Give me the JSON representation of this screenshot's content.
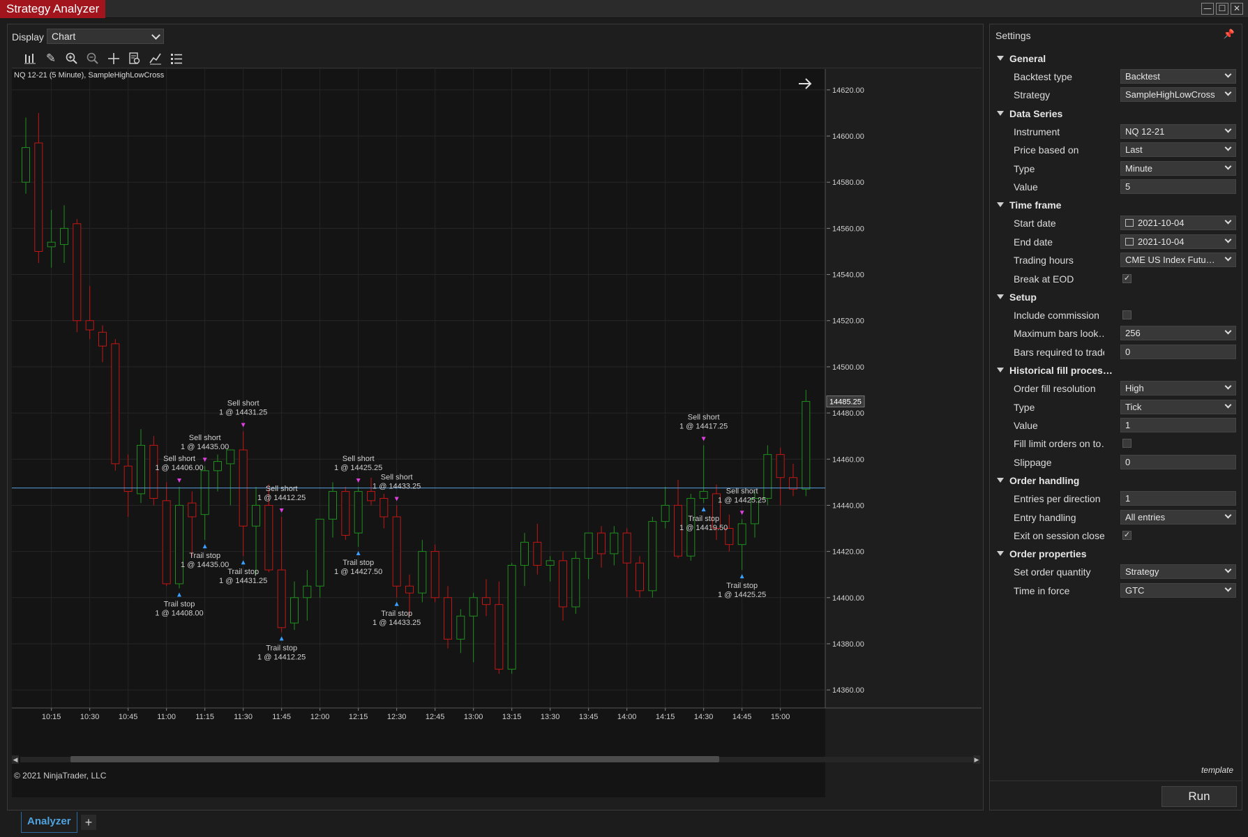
{
  "app_title": "Strategy Analyzer",
  "window_controls": [
    "minimize-icon",
    "maximize-icon",
    "close-icon"
  ],
  "display": {
    "label": "Display",
    "value": "Chart"
  },
  "toolbar_icons": [
    "bar-type-icon",
    "drawing-tool-icon",
    "zoom-in-icon",
    "zoom-out-icon",
    "crosshair-icon",
    "data-box-icon",
    "indicator-icon",
    "properties-list-icon"
  ],
  "chart": {
    "title": "NQ 12-21 (5 Minute), SampleHighLowCross",
    "copyright": "© 2021 NinjaTrader, LLC",
    "last_price_label": "14485.25",
    "horizontal_line_price": 14447.5
  },
  "chart_data": {
    "type": "candlestick",
    "instrument": "NQ 12-21",
    "interval": "5 Minute",
    "x_tick_labels": [
      "10:15",
      "10:30",
      "10:45",
      "11:00",
      "11:15",
      "11:30",
      "11:45",
      "12:00",
      "12:15",
      "12:30",
      "12:45",
      "13:00",
      "13:15",
      "13:30",
      "13:45",
      "14:00",
      "14:15",
      "14:30",
      "14:45",
      "15:00"
    ],
    "y_tick_labels": [
      "14620.00",
      "14600.00",
      "14580.00",
      "14560.00",
      "14540.00",
      "14520.00",
      "14500.00",
      "14480.00",
      "14460.00",
      "14440.00",
      "14420.00",
      "14400.00",
      "14380.00",
      "14360.00"
    ],
    "ylim": [
      14354,
      14626
    ],
    "first_bar_time": "10:05",
    "bar_minutes": 5,
    "colors": {
      "up": "#1f8f1f",
      "down": "#c41616",
      "up_fill": "#141414",
      "down_fill": "#141414",
      "grid": "#262626",
      "hline": "#5aa0e0"
    },
    "candles": [
      [
        14580,
        14608,
        14575,
        14595
      ],
      [
        14597,
        14610,
        14545,
        14550
      ],
      [
        14552,
        14568,
        14543,
        14554
      ],
      [
        14553,
        14570,
        14545,
        14560
      ],
      [
        14562,
        14564,
        14515,
        14520
      ],
      [
        14520,
        14535,
        14512,
        14516
      ],
      [
        14515,
        14518,
        14502,
        14509
      ],
      [
        14510,
        14512,
        14455,
        14458
      ],
      [
        14457,
        14462,
        14435,
        14446
      ],
      [
        14445,
        14473,
        14441,
        14466
      ],
      [
        14466,
        14470,
        14440,
        14443
      ],
      [
        14442,
        14450,
        14405,
        14406
      ],
      [
        14406,
        14448,
        14404,
        14440
      ],
      [
        14441,
        14446,
        14418,
        14435
      ],
      [
        14436,
        14457,
        14425,
        14455
      ],
      [
        14455,
        14462,
        14446,
        14459
      ],
      [
        14458,
        14463,
        14440,
        14464
      ],
      [
        14464,
        14472,
        14418,
        14431
      ],
      [
        14431,
        14448,
        14410,
        14440
      ],
      [
        14440,
        14449,
        14411,
        14412
      ],
      [
        14412,
        14435,
        14385,
        14387
      ],
      [
        14389,
        14407,
        14386,
        14400
      ],
      [
        14400,
        14412,
        14390,
        14405
      ],
      [
        14405,
        14434,
        14400,
        14434
      ],
      [
        14434,
        14450,
        14426,
        14446
      ],
      [
        14446,
        14448,
        14425,
        14427
      ],
      [
        14428,
        14448,
        14422,
        14446
      ],
      [
        14446,
        14452,
        14440,
        14442
      ],
      [
        14443,
        14445,
        14430,
        14435
      ],
      [
        14435,
        14440,
        14400,
        14405
      ],
      [
        14405,
        14410,
        14392,
        14402
      ],
      [
        14402,
        14425,
        14398,
        14420
      ],
      [
        14420,
        14423,
        14398,
        14400
      ],
      [
        14400,
        14405,
        14378,
        14382
      ],
      [
        14382,
        14395,
        14376,
        14392
      ],
      [
        14392,
        14402,
        14372,
        14400
      ],
      [
        14400,
        14408,
        14392,
        14397
      ],
      [
        14397,
        14407,
        14367,
        14369
      ],
      [
        14369,
        14415,
        14367,
        14414
      ],
      [
        14414,
        14428,
        14405,
        14424
      ],
      [
        14424,
        14432,
        14410,
        14414
      ],
      [
        14414,
        14418,
        14407,
        14416
      ],
      [
        14416,
        14420,
        14390,
        14396
      ],
      [
        14396,
        14420,
        14393,
        14417
      ],
      [
        14417,
        14427,
        14408,
        14428
      ],
      [
        14428,
        14431,
        14413,
        14419
      ],
      [
        14419,
        14431,
        14414,
        14428
      ],
      [
        14428,
        14430,
        14400,
        14415
      ],
      [
        14415,
        14418,
        14400,
        14403
      ],
      [
        14403,
        14435,
        14400,
        14433
      ],
      [
        14433,
        14448,
        14430,
        14440
      ],
      [
        14440,
        14451,
        14417,
        14418
      ],
      [
        14418,
        14445,
        14416,
        14443
      ],
      [
        14443,
        14466,
        14441,
        14446
      ],
      [
        14445,
        14449,
        14425,
        14430
      ],
      [
        14430,
        14436,
        14420,
        14423
      ],
      [
        14423,
        14434,
        14412,
        14432
      ],
      [
        14432,
        14446,
        14426,
        14443
      ],
      [
        14443,
        14466,
        14440,
        14462
      ],
      [
        14462,
        14465,
        14440,
        14452
      ],
      [
        14452,
        14458,
        14444,
        14447
      ],
      [
        14447,
        14490,
        14444,
        14485
      ]
    ],
    "executions": [
      {
        "bar": 12,
        "type": "Sell short",
        "qty": 1,
        "price": "14406.00"
      },
      {
        "bar": 12,
        "type": "Trail stop",
        "qty": 1,
        "price": "14408.00"
      },
      {
        "bar": 14,
        "type": "Sell short",
        "qty": 1,
        "price": "14435.00"
      },
      {
        "bar": 14,
        "type": "Trail stop",
        "qty": 1,
        "price": "14435.00"
      },
      {
        "bar": 17,
        "type": "Sell short",
        "qty": 1,
        "price": "14431.25"
      },
      {
        "bar": 17,
        "type": "Trail stop",
        "qty": 1,
        "price": "14431.25"
      },
      {
        "bar": 20,
        "type": "Sell short",
        "qty": 1,
        "price": "14412.25"
      },
      {
        "bar": 20,
        "type": "Trail stop",
        "qty": 1,
        "price": "14412.25"
      },
      {
        "bar": 26,
        "type": "Sell short",
        "qty": 1,
        "price": "14425.25"
      },
      {
        "bar": 26,
        "type": "Trail stop",
        "qty": 1,
        "price": "14427.50"
      },
      {
        "bar": 29,
        "type": "Sell short",
        "qty": 1,
        "price": "14433.25"
      },
      {
        "bar": 29,
        "type": "Trail stop",
        "qty": 1,
        "price": "14433.25"
      },
      {
        "bar": 53,
        "type": "Sell short",
        "qty": 1,
        "price": "14417.25"
      },
      {
        "bar": 53,
        "type": "Trail stop",
        "qty": 1,
        "price": "14419.50"
      },
      {
        "bar": 56,
        "type": "Sell short",
        "qty": 1,
        "price": "14425.25"
      },
      {
        "bar": 56,
        "type": "Trail stop",
        "qty": 1,
        "price": "14425.25"
      }
    ]
  },
  "tabs": {
    "active": "Analyzer",
    "add": "+"
  },
  "settings": {
    "title": "Settings",
    "rows": [
      {
        "kind": "category",
        "label": "General"
      },
      {
        "kind": "select",
        "label": "Backtest type",
        "value": "Backtest"
      },
      {
        "kind": "select",
        "label": "Strategy",
        "value": "SampleHighLowCross"
      },
      {
        "kind": "category",
        "label": "Data Series"
      },
      {
        "kind": "select",
        "label": "Instrument",
        "value": "NQ 12-21"
      },
      {
        "kind": "select",
        "label": "Price based on",
        "value": "Last"
      },
      {
        "kind": "select",
        "label": "Type",
        "value": "Minute"
      },
      {
        "kind": "text",
        "label": "Value",
        "value": "5"
      },
      {
        "kind": "category",
        "label": "Time frame"
      },
      {
        "kind": "date",
        "label": "Start date",
        "value": "2021-10-04"
      },
      {
        "kind": "date",
        "label": "End date",
        "value": "2021-10-04"
      },
      {
        "kind": "select",
        "label": "Trading hours",
        "value": "CME US Index Futu…"
      },
      {
        "kind": "check",
        "label": "Break at EOD",
        "checked": true
      },
      {
        "kind": "category",
        "label": "Setup"
      },
      {
        "kind": "check",
        "label": "Include commission",
        "checked": false
      },
      {
        "kind": "select",
        "label": "Maximum bars look…",
        "value": "256"
      },
      {
        "kind": "text",
        "label": "Bars required to trade",
        "value": "0"
      },
      {
        "kind": "category",
        "label": "Historical fill proces…"
      },
      {
        "kind": "select",
        "label": "Order fill resolution",
        "value": "High"
      },
      {
        "kind": "select",
        "label": "Type",
        "value": "Tick"
      },
      {
        "kind": "text",
        "label": "Value",
        "value": "1"
      },
      {
        "kind": "check",
        "label": "Fill limit orders on to…",
        "checked": false
      },
      {
        "kind": "text",
        "label": "Slippage",
        "value": "0"
      },
      {
        "kind": "category",
        "label": "Order handling"
      },
      {
        "kind": "text",
        "label": "Entries per direction",
        "value": "1"
      },
      {
        "kind": "select",
        "label": "Entry handling",
        "value": "All entries"
      },
      {
        "kind": "check",
        "label": "Exit on session close",
        "checked": true
      },
      {
        "kind": "category",
        "label": "Order properties"
      },
      {
        "kind": "select",
        "label": "Set order quantity",
        "value": "Strategy"
      },
      {
        "kind": "select",
        "label": "Time in force",
        "value": "GTC"
      }
    ],
    "template_link": "template",
    "run_label": "Run"
  }
}
